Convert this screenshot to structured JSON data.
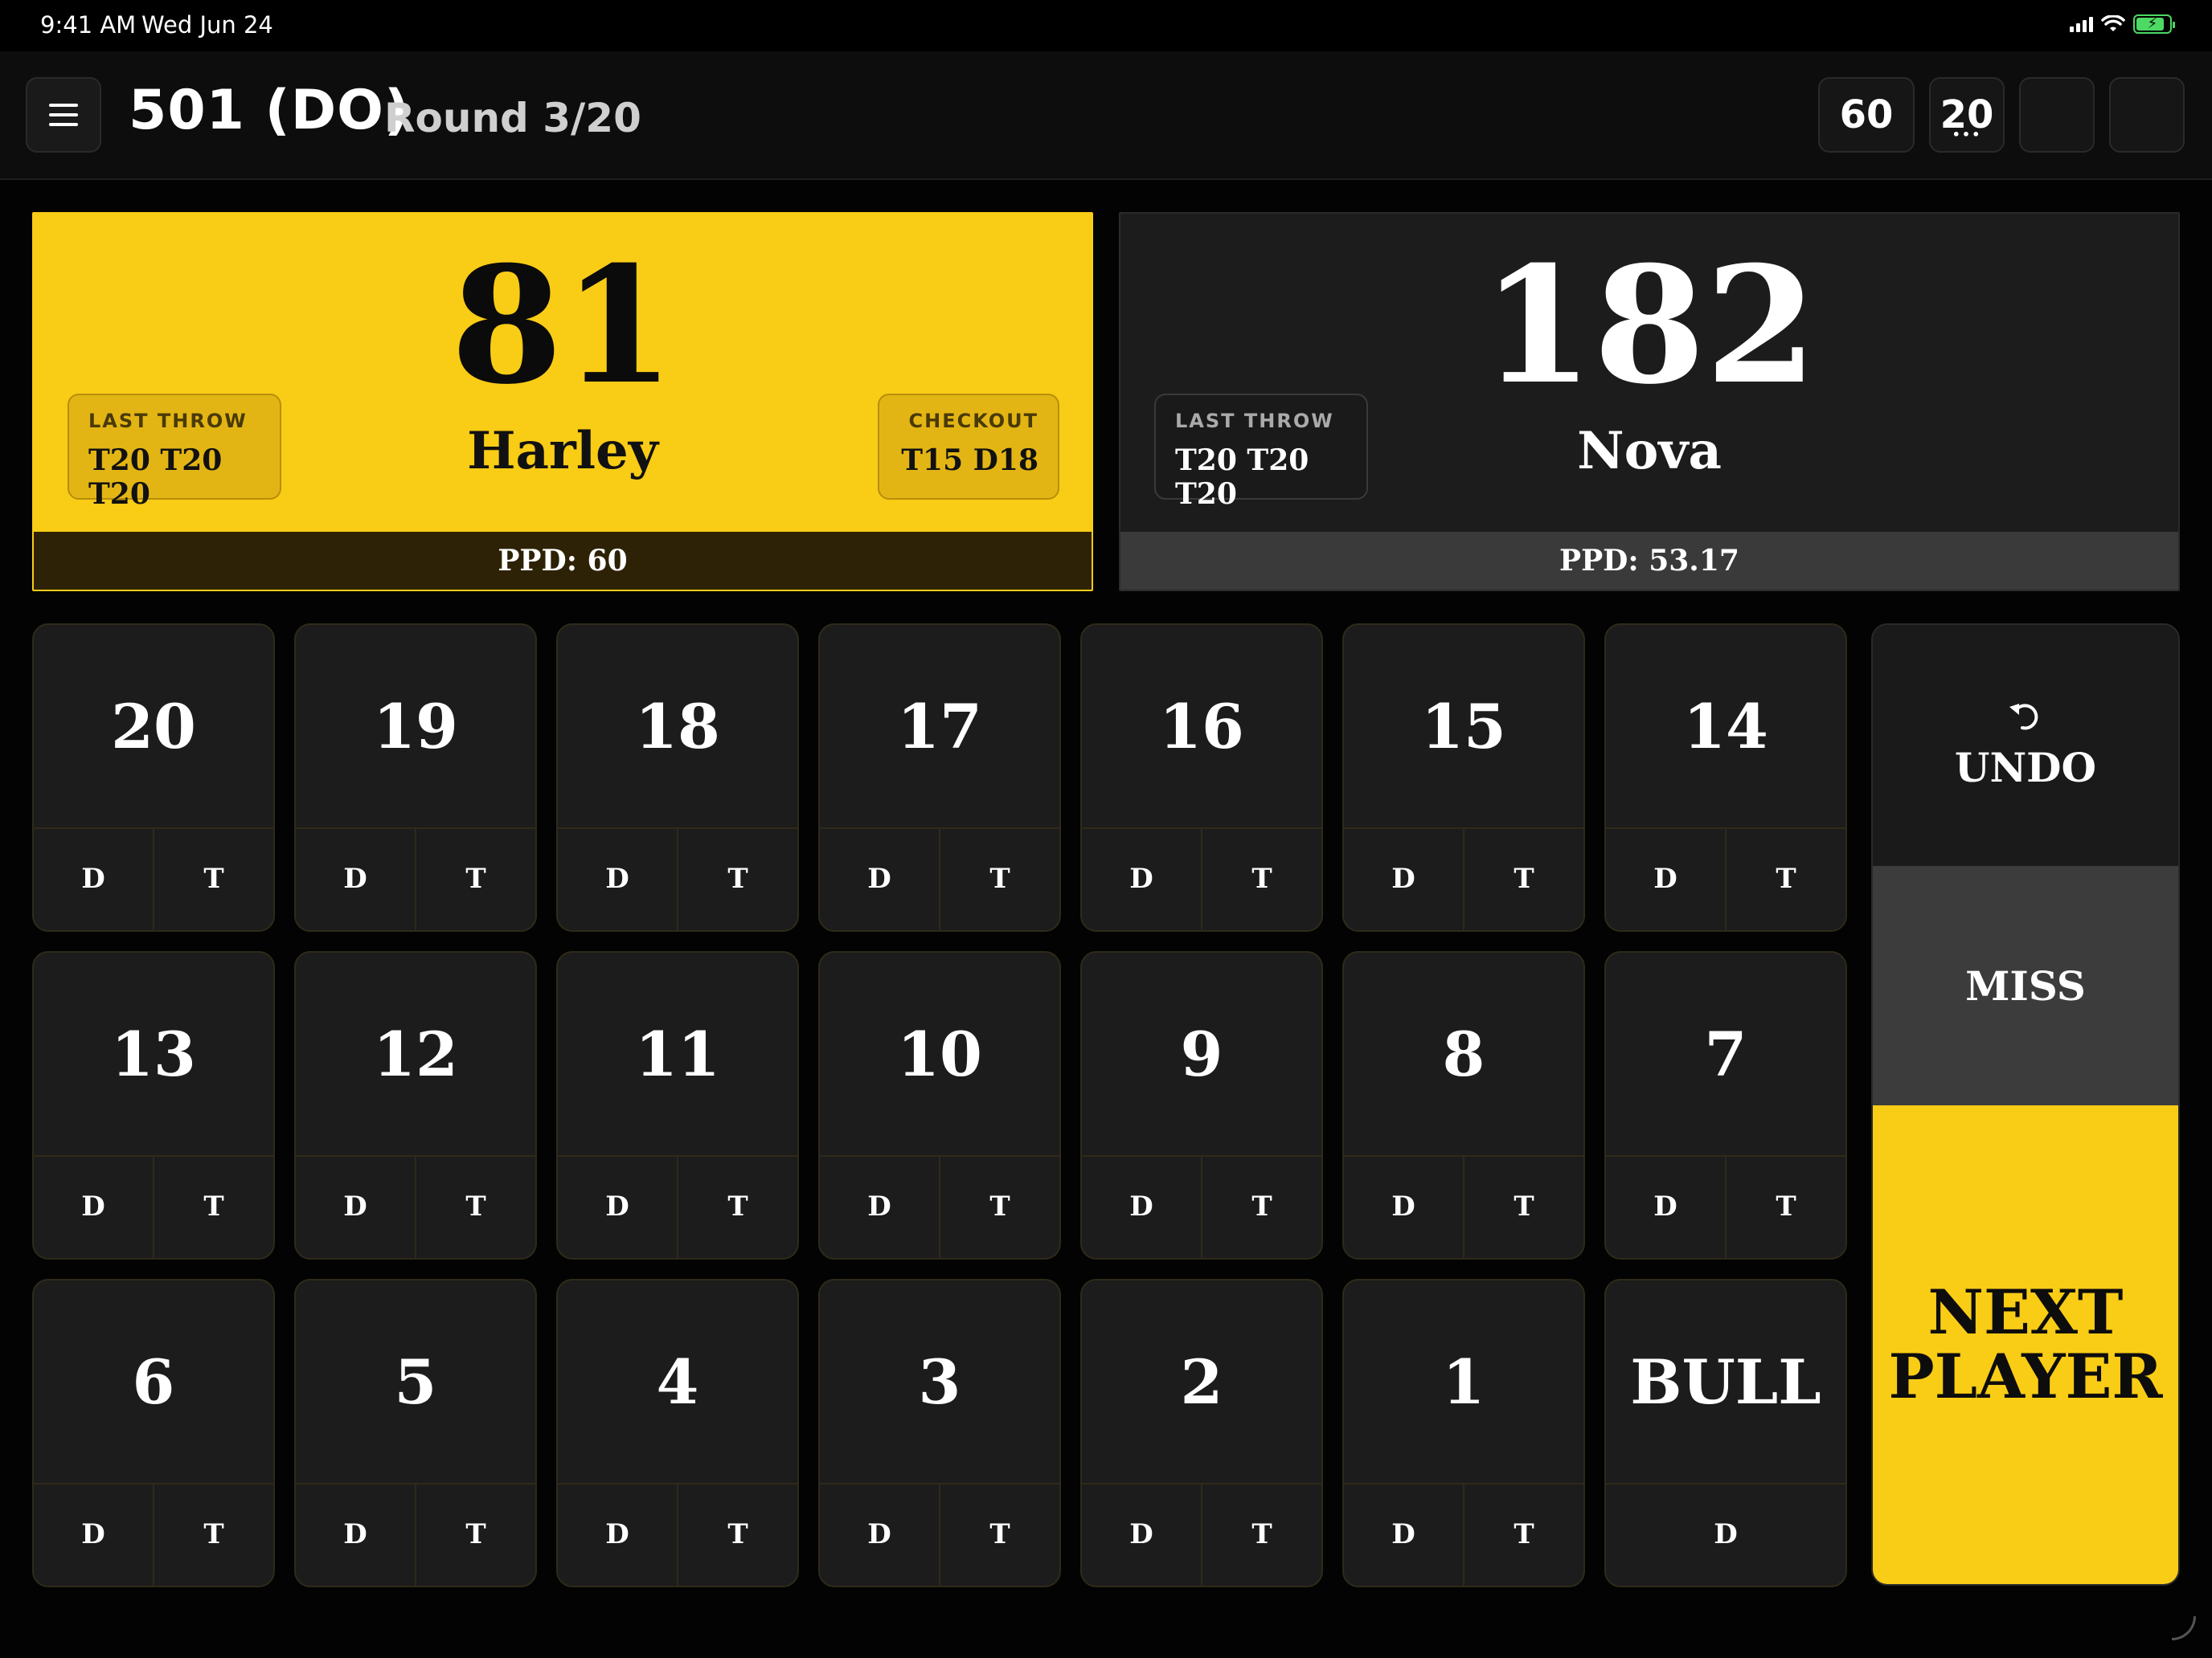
{
  "status_bar": {
    "time": "9:41 AM",
    "date": "Wed Jun 24",
    "battery_icon": "battery-charging-icon"
  },
  "header": {
    "game_title": "501 (DO)",
    "round": "Round 3/20",
    "buttons": [
      {
        "label": "60"
      },
      {
        "label": "20",
        "sub": "•••"
      },
      {
        "label": ""
      },
      {
        "label": ""
      }
    ]
  },
  "players": [
    {
      "score": "81",
      "name": "Harley",
      "last_throw_label": "LAST THROW",
      "last_throw": "T20 T20 T20",
      "checkout_label": "CHECKOUT",
      "checkout": "T15 D18",
      "ppd": "PPD: 60",
      "active": true
    },
    {
      "score": "182",
      "name": "Nova",
      "last_throw_label": "LAST THROW",
      "last_throw": "T20 T20 T20",
      "ppd": "PPD: 53.17",
      "active": false
    }
  ],
  "keypad": {
    "double_label": "D",
    "triple_label": "T",
    "keys": [
      "20",
      "19",
      "18",
      "17",
      "16",
      "15",
      "14",
      "13",
      "12",
      "11",
      "10",
      "9",
      "8",
      "7",
      "6",
      "5",
      "4",
      "3",
      "2",
      "1",
      "BULL"
    ]
  },
  "actions": {
    "undo": "UNDO",
    "miss": "MISS",
    "next_player": "NEXT PLAYER"
  },
  "colors": {
    "accent": "#f9cc16",
    "background": "#030303",
    "tile": "#1c1c1c",
    "miss": "#3c3c3c"
  }
}
